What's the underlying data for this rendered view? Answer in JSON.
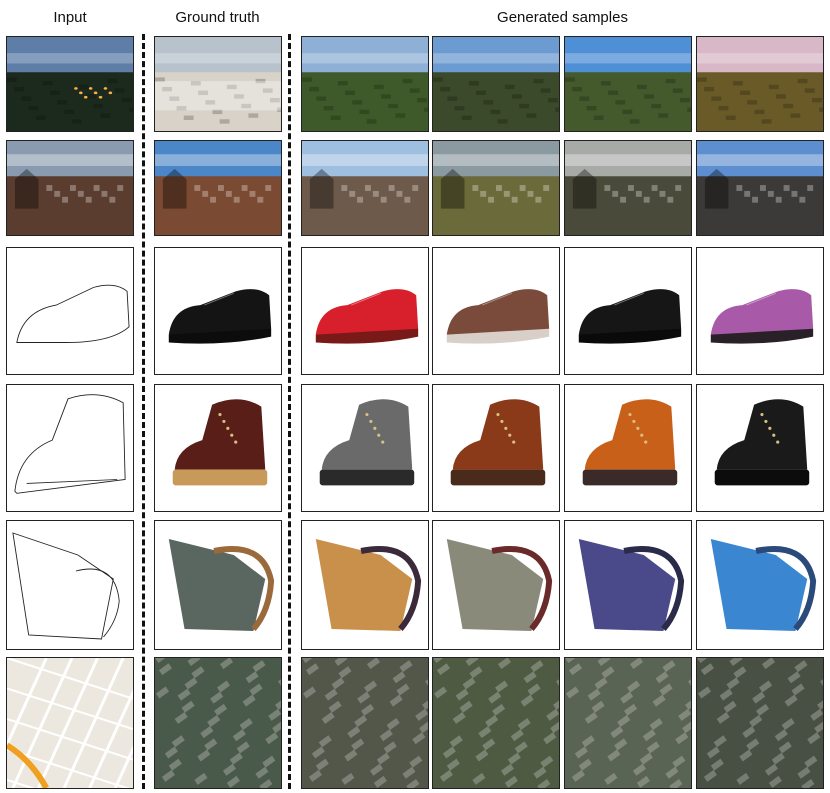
{
  "headers": {
    "input": "Input",
    "ground_truth": "Ground truth",
    "generated": "Generated samples"
  },
  "rows": [
    {
      "name": "city-dusk",
      "kind": "city",
      "input": {
        "type": "photo-city",
        "sky": "#5e7ea8",
        "ground": "#1c2a1e",
        "lights": true
      },
      "truth": {
        "type": "photo-city",
        "sky": "#b7c2cc",
        "ground": "#d8d2c8",
        "snow": true
      },
      "samples": [
        {
          "sky": "#8fb0d6",
          "ground": "#3f5a2a"
        },
        {
          "sky": "#6b9bd0",
          "ground": "#3a4a2a"
        },
        {
          "sky": "#4f8fd6",
          "ground": "#445a2c"
        },
        {
          "sky": "#d8b8c6",
          "ground": "#6a5a28"
        }
      ]
    },
    {
      "name": "town-church",
      "kind": "town",
      "input": {
        "type": "photo-town",
        "sky": "#8a9bb0",
        "ground": "#5a3d2e"
      },
      "truth": {
        "type": "photo-town",
        "sky": "#4a86c8",
        "ground": "#7a4a32"
      },
      "samples": [
        {
          "sky": "#9fbfe0",
          "ground": "#6e5a4a"
        },
        {
          "sky": "#8a9aa0",
          "ground": "#6a6a3a"
        },
        {
          "sky": "#a8aaa8",
          "ground": "#4a4a3a"
        },
        {
          "sky": "#5c8ed0",
          "ground": "#3c3a38"
        }
      ]
    },
    {
      "name": "shoe-oxford",
      "kind": "shoe",
      "input": {
        "type": "edges-shoe"
      },
      "truth": {
        "type": "shoe",
        "color": "#141414",
        "sole": "#0c0c0c"
      },
      "samples": [
        {
          "color": "#d8202c",
          "sole": "#7a1a18"
        },
        {
          "color": "#7a4a3a",
          "sole": "#d8d0c8"
        },
        {
          "color": "#161616",
          "sole": "#0a0a0a"
        },
        {
          "color": "#a85aa8",
          "sole": "#2a2028"
        }
      ]
    },
    {
      "name": "boot",
      "kind": "boot",
      "input": {
        "type": "edges-boot"
      },
      "truth": {
        "type": "boot",
        "color": "#5a1e18",
        "sole": "#c89a5a"
      },
      "samples": [
        {
          "color": "#6a6a6a",
          "sole": "#2a2a2a"
        },
        {
          "color": "#8a3a18",
          "sole": "#4a2a1a"
        },
        {
          "color": "#c8601a",
          "sole": "#3a2a2a"
        },
        {
          "color": "#1a1a1a",
          "sole": "#0c0c0c"
        }
      ]
    },
    {
      "name": "handbag",
      "kind": "bag",
      "input": {
        "type": "edges-bag"
      },
      "truth": {
        "type": "bag",
        "color": "#5a6660",
        "strap": "#9a6a3a"
      },
      "samples": [
        {
          "color": "#c8904a",
          "strap": "#3a2a3a"
        },
        {
          "color": "#8a8a7a",
          "strap": "#6a2a2a"
        },
        {
          "color": "#4a4a8a",
          "strap": "#2a2a4a"
        },
        {
          "color": "#3a86d0",
          "strap": "#2a4a7a"
        }
      ]
    },
    {
      "name": "map-aerial",
      "kind": "aerial",
      "input": {
        "type": "map"
      },
      "truth": {
        "type": "aerial",
        "tone": "#4a5a4a"
      },
      "samples": [
        {
          "tone": "#52574a"
        },
        {
          "tone": "#4e5a42"
        },
        {
          "tone": "#5a6454"
        },
        {
          "tone": "#485044"
        }
      ]
    }
  ]
}
